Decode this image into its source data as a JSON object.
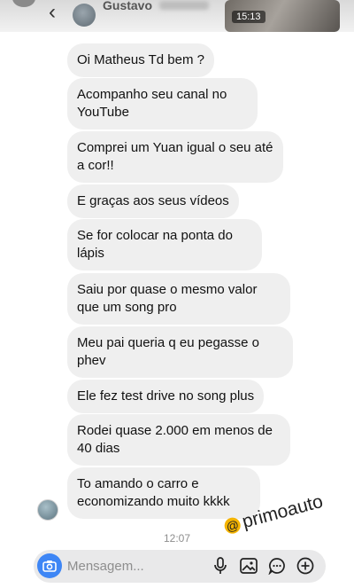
{
  "header": {
    "contact_name": "Gustavo",
    "video_time": "15:13"
  },
  "messages": [
    "Oi Matheus Td bem ?",
    "Acompanho seu canal no YouTube",
    "Comprei um Yuan igual o seu até a cor!!",
    "E graças aos seus vídeos",
    "Se for colocar na ponta do lápis",
    "Saiu por quase o mesmo valor que um song pro",
    "Meu pai queria q eu pegasse o phev",
    "Ele fez test drive no song plus",
    "Rodei quase 2.000 em menos de 40 dias",
    "To amando o carro e economizando muito kkkk"
  ],
  "timestamp": "12:07",
  "watermark": "primoauto",
  "composer": {
    "placeholder": "Mensagem..."
  },
  "colors": {
    "bubble": "#efefef",
    "camera_button": "#3e86f5",
    "watermark_badge": "#f5b400"
  }
}
